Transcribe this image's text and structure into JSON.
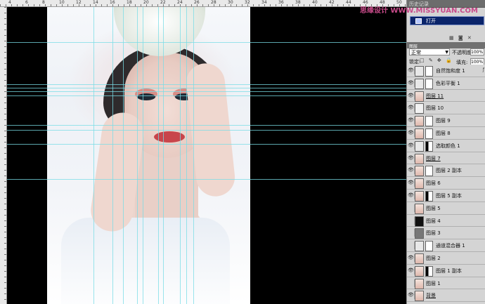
{
  "watermark": "思缘设计 WWW.MISSYUAN.COM",
  "ruler": {
    "top_numbers": [
      "4",
      "6",
      "8",
      "10",
      "12",
      "14",
      "16",
      "18",
      "20",
      "22",
      "24",
      "26",
      "28",
      "30",
      "32",
      "34",
      "36",
      "38",
      "40",
      "42",
      "44",
      "46",
      "48",
      "50"
    ]
  },
  "history_panel": {
    "tab_label": "历史记录",
    "items": [
      {
        "label": "打开",
        "selected": true
      }
    ],
    "tool_icons": "▦ ◙ ✕"
  },
  "layers_panel": {
    "tab_label": "图层",
    "blend_mode": "正常",
    "opacity_label": "不透明度:",
    "opacity_value": "100%",
    "lock_label": "锁定:",
    "lock_icons": "□ ✎ ✥ 🔒",
    "fill_label": "填充:",
    "fill_value": "100%",
    "layers": [
      {
        "name": "自然饱和度 1",
        "visible": true,
        "thumb": "adjust",
        "has_mask": true,
        "chain": true,
        "fx": "ƒ"
      },
      {
        "name": "色彩平衡 1",
        "visible": true,
        "thumb": "adjust",
        "has_mask": true,
        "chain": true,
        "fx": ""
      },
      {
        "name": "图层 11",
        "visible": true,
        "thumb": "photo",
        "has_mask": false,
        "chain": false,
        "underline": true,
        "fx": ""
      },
      {
        "name": "图层 10",
        "visible": true,
        "thumb": "light",
        "has_mask": false,
        "chain": false,
        "fx": ""
      },
      {
        "name": "图层 9",
        "visible": true,
        "thumb": "photo",
        "has_mask": true,
        "chain": true,
        "fx": ""
      },
      {
        "name": "图层 8",
        "visible": true,
        "thumb": "photo",
        "has_mask": true,
        "chain": true,
        "fx": ""
      },
      {
        "name": "选取颜色 1",
        "visible": true,
        "thumb": "adjust",
        "has_mask": true,
        "mask_bw": true,
        "chain": true,
        "fx": ""
      },
      {
        "name": "图层 7",
        "visible": true,
        "thumb": "photo",
        "has_mask": false,
        "chain": false,
        "underline": true,
        "fx": ""
      },
      {
        "name": "图层 2 副本",
        "visible": true,
        "thumb": "photo",
        "has_mask": true,
        "chain": true,
        "fx": ""
      },
      {
        "name": "图层 6",
        "visible": true,
        "thumb": "photo",
        "has_mask": false,
        "chain": false,
        "fx": ""
      },
      {
        "name": "图层 5 副本",
        "visible": true,
        "thumb": "photo",
        "has_mask": true,
        "mask_bw": true,
        "chain": true,
        "fx": ""
      },
      {
        "name": "图层 5",
        "visible": false,
        "thumb": "photo",
        "has_mask": false,
        "chain": false,
        "fx": ""
      },
      {
        "name": "图层 4",
        "visible": false,
        "thumb": "dark",
        "has_mask": false,
        "chain": false,
        "fx": ""
      },
      {
        "name": "图层 3",
        "visible": false,
        "thumb": "grey",
        "has_mask": false,
        "chain": false,
        "fx": ""
      },
      {
        "name": "通道混合器 1",
        "visible": false,
        "thumb": "adjust",
        "has_mask": true,
        "chain": true,
        "fx": ""
      },
      {
        "name": "图层 2",
        "visible": true,
        "thumb": "photo",
        "has_mask": false,
        "chain": false,
        "fx": ""
      },
      {
        "name": "图层 1 副本",
        "visible": true,
        "thumb": "photo",
        "has_mask": true,
        "mask_bw": true,
        "chain": true,
        "fx": ""
      },
      {
        "name": "图层 1",
        "visible": false,
        "thumb": "photo",
        "has_mask": false,
        "chain": false,
        "fx": ""
      },
      {
        "name": "背景",
        "visible": true,
        "thumb": "photo",
        "has_mask": false,
        "chain": false,
        "underline": true,
        "fx": ""
      }
    ]
  }
}
